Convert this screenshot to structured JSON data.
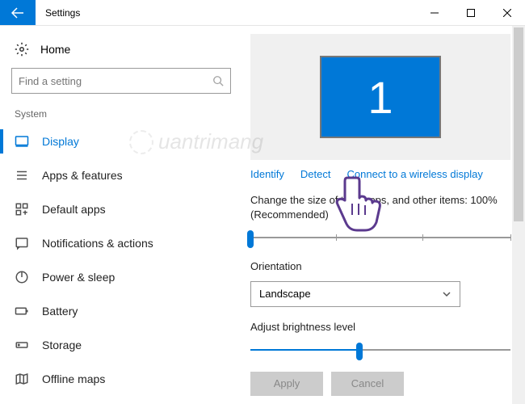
{
  "window": {
    "title": "Settings"
  },
  "home": {
    "label": "Home"
  },
  "search": {
    "placeholder": "Find a setting"
  },
  "section_label": "System",
  "nav": [
    {
      "label": "Display",
      "selected": true
    },
    {
      "label": "Apps & features",
      "selected": false
    },
    {
      "label": "Default apps",
      "selected": false
    },
    {
      "label": "Notifications & actions",
      "selected": false
    },
    {
      "label": "Power & sleep",
      "selected": false
    },
    {
      "label": "Battery",
      "selected": false
    },
    {
      "label": "Storage",
      "selected": false
    },
    {
      "label": "Offline maps",
      "selected": false
    }
  ],
  "display": {
    "monitor_id": "1",
    "links": {
      "identify": "Identify",
      "detect": "Detect",
      "wireless": "Connect to a wireless display"
    },
    "scale_label_1": "Change the size of text, apps, and other items: 100%",
    "scale_label_2": "(Recommended)",
    "scale_value_percent": 0,
    "orientation_label": "Orientation",
    "orientation_value": "Landscape",
    "brightness_label": "Adjust brightness level",
    "brightness_value_percent": 42,
    "apply": "Apply",
    "cancel": "Cancel"
  },
  "watermark": "uantrimang"
}
